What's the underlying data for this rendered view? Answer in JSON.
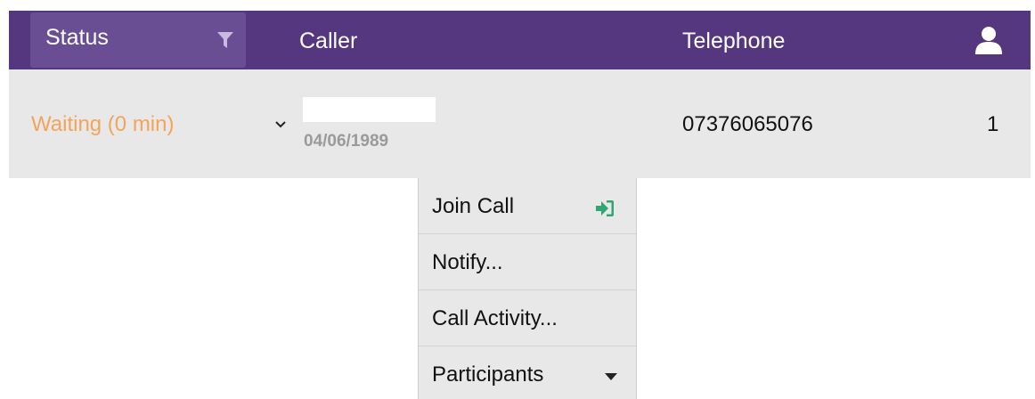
{
  "header": {
    "status_label": "Status",
    "caller_label": "Caller",
    "telephone_label": "Telephone",
    "filter_icon": "filter-icon",
    "user_icon": "user-icon"
  },
  "row": {
    "status": "Waiting (0 min)",
    "caller_name": "",
    "caller_dob": "04/06/1989",
    "telephone": "07376065076",
    "count": "1",
    "expand_icon": "chevron-down-icon"
  },
  "menu": {
    "items": [
      {
        "label": "Join Call",
        "icon": "sign-in-icon"
      },
      {
        "label": "Notify..."
      },
      {
        "label": "Call Activity..."
      },
      {
        "label": "Participants",
        "icon": "caret-down-icon"
      }
    ]
  },
  "colors": {
    "header_bg": "#55377f",
    "status_header_bg": "#6a4e94",
    "row_bg": "#e8e8e8",
    "status_waiting": "#f2a55a",
    "join_icon": "#2ea774"
  }
}
